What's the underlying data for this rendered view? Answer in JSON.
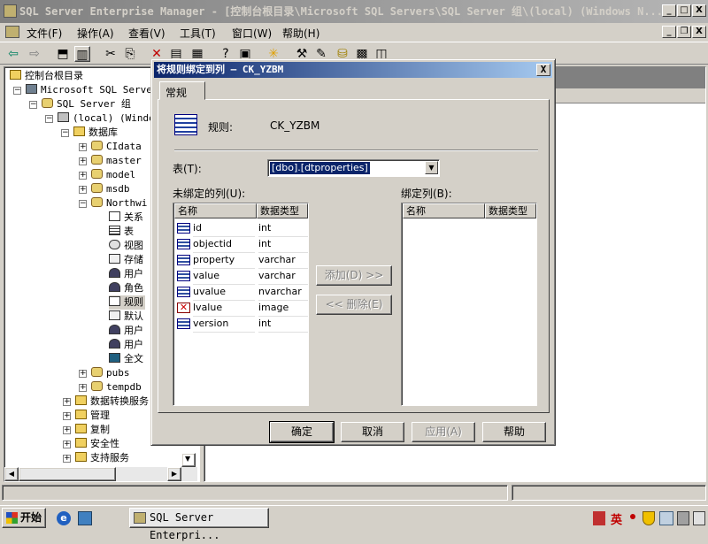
{
  "window": {
    "title": "SQL Server Enterprise Manager - [控制台根目录\\Microsoft SQL Servers\\SQL Server 组\\(local) (Windows N...",
    "min": "_",
    "max": "□",
    "close": "X"
  },
  "menu": [
    "文件(F)",
    "操作(A)",
    "查看(V)",
    "工具(T)",
    "窗口(W)",
    "帮助(H)"
  ],
  "tree": {
    "root": "控制台根目录",
    "ms_sql": "Microsoft SQL Server",
    "group": "SQL Server 组",
    "local": "(local) (Windo",
    "databases": "数据库",
    "db_items": [
      "CIdata",
      "master",
      "model",
      "msdb",
      "Northwi"
    ],
    "north_children": [
      "关系",
      "表",
      "视图",
      "存储",
      "用户",
      "角色",
      "规则",
      "默认",
      "用户",
      "用户",
      "全文"
    ],
    "db_items2": [
      "pubs",
      "tempdb"
    ],
    "other": [
      "数据转换服务",
      "管理",
      "复制",
      "安全性",
      "支持服务"
    ]
  },
  "dialog": {
    "title": "将规则绑定到列 — CK_YZBM",
    "close": "X",
    "tab": "常规",
    "rule_label": "规则:",
    "rule_value": "CK_YZBM",
    "table_label": "表(T):",
    "table_value": "[dbo].[dtproperties]",
    "unbound_label": "未绑定的列(U):",
    "bound_label": "绑定列(B):",
    "col_name": "名称",
    "col_type": "数据类型",
    "columns": [
      {
        "name": "id",
        "type": "int",
        "icon": "column-icon"
      },
      {
        "name": "objectid",
        "type": "int",
        "icon": "column-icon"
      },
      {
        "name": "property",
        "type": "varchar",
        "icon": "column-icon"
      },
      {
        "name": "value",
        "type": "varchar",
        "icon": "column-icon"
      },
      {
        "name": "uvalue",
        "type": "nvarchar",
        "icon": "column-icon"
      },
      {
        "name": "lvalue",
        "type": "image",
        "icon": "disabled-column-icon"
      },
      {
        "name": "version",
        "type": "int",
        "icon": "column-icon"
      }
    ],
    "add_btn": "添加(D) >>",
    "remove_btn": "<< 删除(E)",
    "ok": "确定",
    "cancel": "取消",
    "apply": "应用(A)",
    "help": "帮助"
  },
  "taskbar": {
    "start": "开始",
    "task": "SQL Server Enterpri...",
    "ime": "英"
  }
}
